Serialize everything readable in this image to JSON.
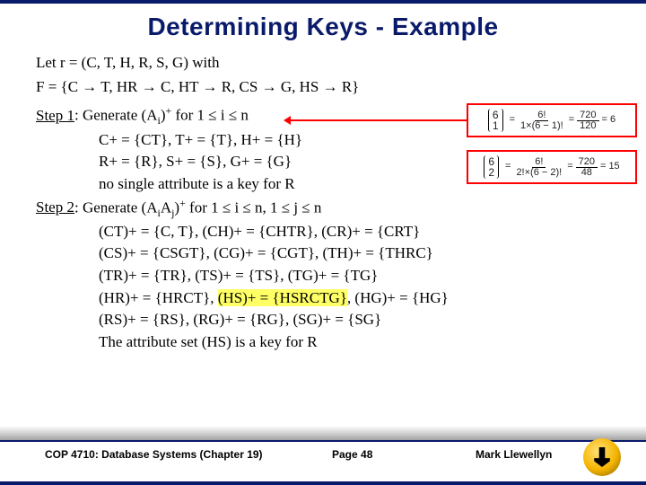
{
  "title": "Determining Keys - Example",
  "intro": {
    "line1_a": "Let r = (C, T, H, R, S, G) with",
    "line2_a": "F = {C ",
    "line2_b": " T, HR ",
    "line2_c": " C, HT ",
    "line2_d": " R, CS ",
    "line2_e": " G, HS ",
    "line2_f": " R}"
  },
  "step1": {
    "head_a": "Step 1",
    "head_b": ": Generate (A",
    "head_c": ")",
    "head_d": " for 1 ≤ i ≤ n",
    "sub_i": "i",
    "sup_plus": "+",
    "l1": "C+ = {CT},   T+ = {T},   H+ = {H}",
    "l2": "R+ = {R},      S+ = {S},    G+ = {G}",
    "l3": "no single attribute is a key for R"
  },
  "step2": {
    "head_a": "Step 2",
    "head_b": ": Generate (A",
    "head_c": "A",
    "head_d": ")",
    "head_e": " for 1 ≤ i ≤ n, 1 ≤ j ≤ n",
    "sub_i": "i",
    "sub_j": "j",
    "sup_plus": "+",
    "l1": "(CT)+ = {C, T},   (CH)+ = {CHTR},   (CR)+ = {CRT}",
    "l2": "(CS)+ = {CSGT},   (CG)+ = {CGT},    (TH)+ = {THRC}",
    "l3": "(TR)+ = {TR},   (TS)+ = {TS},  (TG)+ = {TG}",
    "l4a": "(HR)+ = {HRCT},   ",
    "l4b": "(HS)+ = {HSRCTG}",
    "l4c": ",   (HG)+ = {HG}",
    "l5": "(RS)+ = {RS},   (RG)+ = {RG},   (SG)+ = {SG}",
    "l6": "The attribute set (HS) is a key for R"
  },
  "formula1": {
    "binom_top": "6",
    "binom_bot": "1",
    "frac1_num": "6!",
    "frac1_den": "1×(6 − 1)!",
    "mid": "720",
    "mid_den": "120",
    "result": "6"
  },
  "formula2": {
    "binom_top": "6",
    "binom_bot": "2",
    "frac1_num": "6!",
    "frac1_den": "2!×(6 − 2)!",
    "mid": "720",
    "mid_den": "48",
    "result": "15"
  },
  "footer": {
    "course": "COP 4710: Database Systems  (Chapter 19)",
    "page": "Page 48",
    "author": "Mark Llewellyn"
  },
  "glyph": {
    "arrow": "→"
  }
}
